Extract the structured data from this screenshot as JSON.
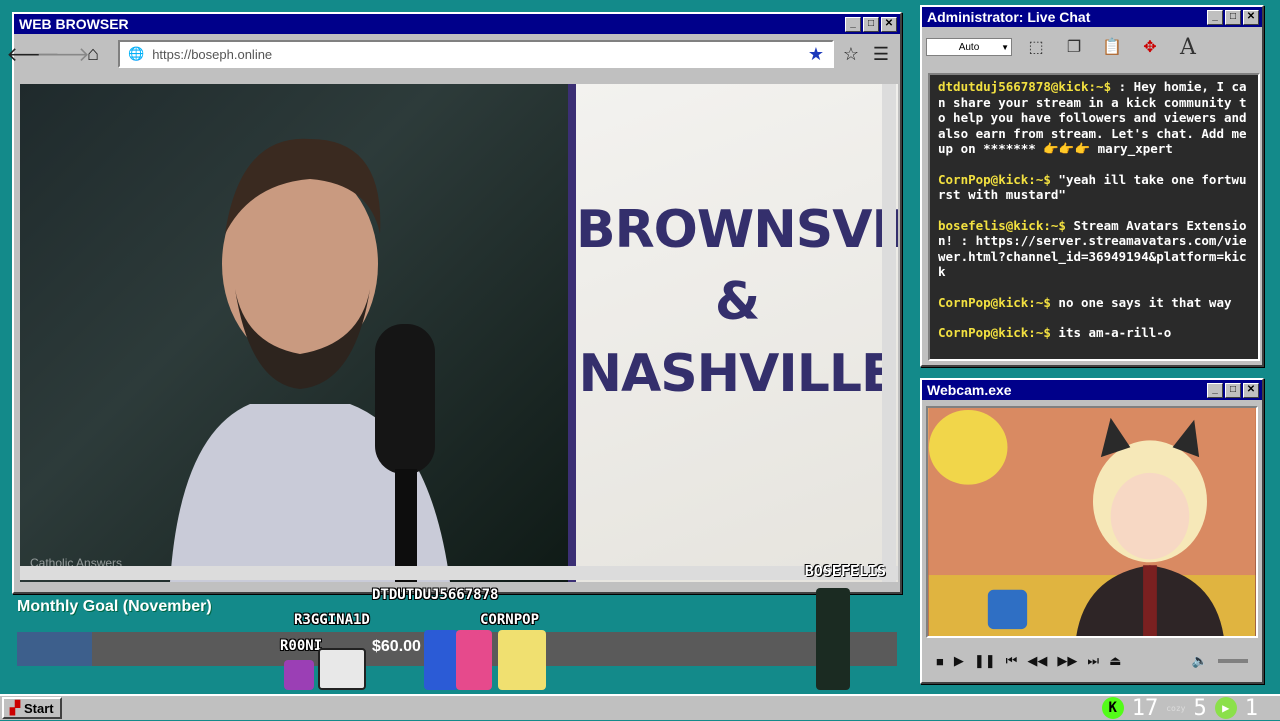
{
  "browser": {
    "title": "WEB BROWSER",
    "url": "https://boseph.online",
    "slide_lines": [
      "BROWNSVILLE",
      "&",
      "NASHVILLE"
    ],
    "watermark": "Catholic Answers",
    "streamer": "BOSEFELIS"
  },
  "chat": {
    "title": "Administrator: Live Chat",
    "font_size": "Auto",
    "messages": [
      {
        "user": "dtdutduj5667878@kick:~$",
        "text": " : Hey homie, I can share your stream in a kick community to help you have followers and viewers and also earn from stream. Let's chat. Add me up on ******* 👉👉👉 mary_xpert"
      },
      {
        "user": "CornPop@kick:~$",
        "text": " \"yeah ill take one fortwurst with mustard\""
      },
      {
        "user": "bosefelis@kick:~$",
        "text": " Stream Avatars Extension! : https://server.streamavatars.com/viewer.html?channel_id=36949194&platform=kick"
      },
      {
        "user": "CornPop@kick:~$",
        "text": " no one says it that way"
      },
      {
        "user": "CornPop@kick:~$",
        "text": " its am-a-rill-o"
      }
    ]
  },
  "webcam": {
    "title": "Webcam.exe"
  },
  "goal": {
    "title": "Monthly Goal (November)",
    "amount": "$60.00",
    "progress": 0.085
  },
  "avatars": {
    "names": [
      "DTDUTDUJ5667878",
      "R3GGINA1D",
      "CORNPOP",
      "R00NI"
    ]
  },
  "taskbar": {
    "start": "Start",
    "count_a": "17",
    "count_b": "5",
    "count_c": "1",
    "cozy": "cozy"
  },
  "colors": {
    "titlebar": "#00008a",
    "desktop": "#138a8a",
    "chat_user": "#f2e040",
    "kick": "#53fc18"
  }
}
